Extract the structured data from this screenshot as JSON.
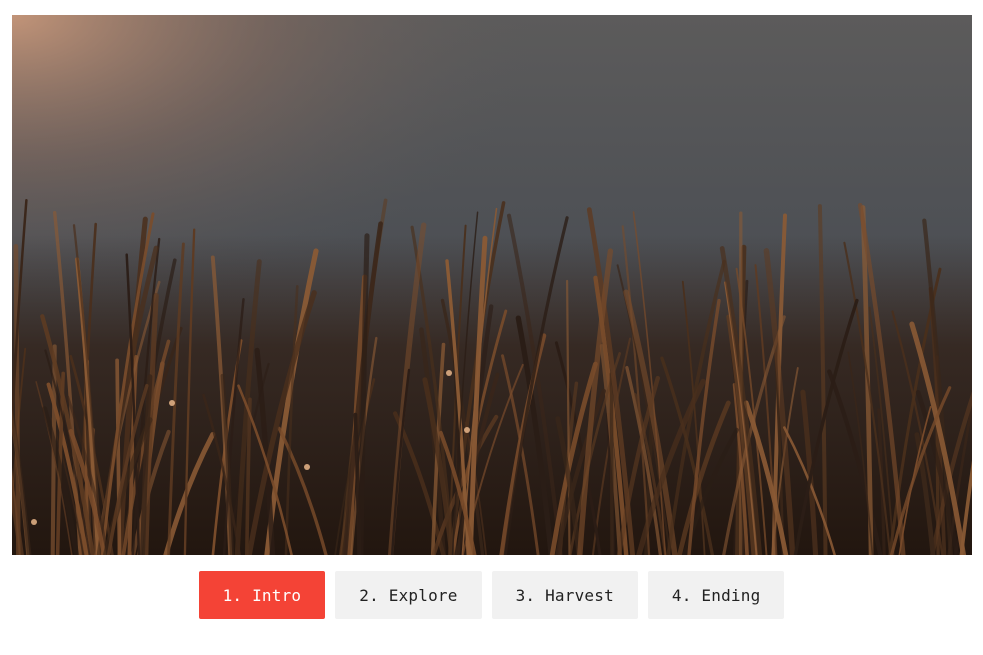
{
  "video": {
    "scene": "grass-at-dusk",
    "colors": {
      "sky_top": "#5f5e5e",
      "sky_glow": "#c9977a",
      "sky_mid": "#4e5156",
      "grass_dark": "#2b1d16",
      "grass_light": "#8a5a35"
    }
  },
  "chapters": [
    {
      "label": "1. Intro",
      "active": true
    },
    {
      "label": "2. Explore",
      "active": false
    },
    {
      "label": "3. Harvest",
      "active": false
    },
    {
      "label": "4. Ending",
      "active": false
    }
  ],
  "accent_color": "#f44336"
}
